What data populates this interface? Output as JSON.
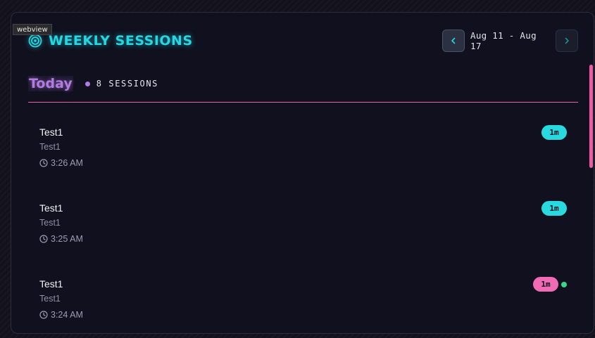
{
  "webview_label": "webview",
  "header": {
    "title": "WEEKLY SESSIONS",
    "icon": "target-icon",
    "accent": "#26d6e2"
  },
  "week_nav": {
    "range": "Aug 11 - Aug 17",
    "prev_icon": "chevron-left-icon",
    "next_icon": "chevron-right-icon"
  },
  "day": {
    "title": "Today",
    "session_count": "8 SESSIONS",
    "accent": "#b27be0"
  },
  "sessions": [
    {
      "title": "Test1",
      "subtitle": "Test1",
      "time": "3:26 AM",
      "duration": "1m",
      "badge_color": "#28dadf",
      "live": false
    },
    {
      "title": "Test1",
      "subtitle": "Test1",
      "time": "3:25 AM",
      "duration": "1m",
      "badge_color": "#28dadf",
      "live": false
    },
    {
      "title": "Test1",
      "subtitle": "Test1",
      "time": "3:24 AM",
      "duration": "1m",
      "badge_color": "#f06bb4",
      "live": true
    }
  ]
}
